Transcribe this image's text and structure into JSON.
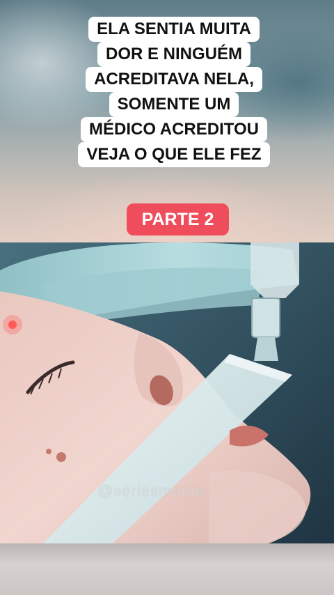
{
  "headline": {
    "lines": [
      "ELA SENTIA MUITA",
      "DOR E NINGUÉM",
      "ACREDITAVA NELA,",
      "SOMENTE UM",
      "MÉDICO ACREDITOU",
      "VEJA O QUE ELE FEZ"
    ]
  },
  "badge": {
    "label": "PARTE 2",
    "color": "#ef4d5c"
  },
  "video": {
    "watermark": "@seriesmania"
  }
}
